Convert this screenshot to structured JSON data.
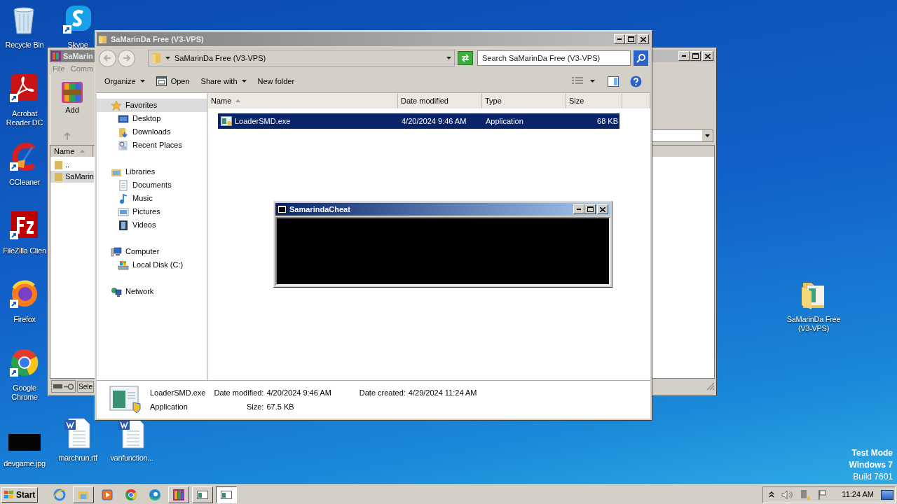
{
  "desktop": {
    "icons": [
      {
        "label": "Recycle Bin",
        "kind": "recycle",
        "shortcut": false
      },
      {
        "label": "Skype",
        "kind": "skype",
        "shortcut": true
      },
      {
        "label": "Acrobat Reader DC",
        "kind": "acrobat",
        "shortcut": true
      },
      {
        "label": "CCleaner",
        "kind": "ccleaner",
        "shortcut": true
      },
      {
        "label": "FileZilla Clien",
        "kind": "filezilla",
        "shortcut": true
      },
      {
        "label": "Firefox",
        "kind": "firefox",
        "shortcut": true
      },
      {
        "label": "Google Chrome",
        "kind": "chrome",
        "shortcut": true
      },
      {
        "label": "devgame.jpg",
        "kind": "image",
        "shortcut": false
      },
      {
        "label": "marchrun.rtf",
        "kind": "word",
        "shortcut": false
      },
      {
        "label": "vanfunction...",
        "kind": "word",
        "shortcut": false
      },
      {
        "label": "SaMarinDa Free (V3-VPS)",
        "kind": "folder",
        "shortcut": false
      }
    ],
    "os_notice": [
      "Test Mode",
      "Windows 7",
      "Build 7601"
    ]
  },
  "background_window": {
    "title": "SaMarin",
    "menu": [
      "File",
      "Comm"
    ],
    "toolbar": [
      "Add"
    ],
    "column": "Name",
    "rows": [
      {
        "name": "..",
        "selected": false
      },
      {
        "name": "SaMarin",
        "selected": true
      }
    ],
    "status": "Sele"
  },
  "explorer": {
    "title": "SaMarinDa Free (V3-VPS)",
    "address": "SaMarinDa Free (V3-VPS)",
    "search": {
      "placeholder": "Search SaMarinDa Free (V3-VPS)"
    },
    "toolbar": [
      {
        "label": "Organize",
        "kind": "menu"
      },
      {
        "label": "Open",
        "kind": "open"
      },
      {
        "label": "Share with",
        "kind": "menu"
      },
      {
        "label": "New folder",
        "kind": "plain"
      }
    ],
    "nav": [
      {
        "label": "Favorites",
        "kind": "star",
        "selected": true,
        "children": [
          {
            "label": "Desktop",
            "kind": "desktop",
            "selected": false
          },
          {
            "label": "Downloads",
            "kind": "downloads",
            "selected": false
          },
          {
            "label": "Recent Places",
            "kind": "recent",
            "selected": false
          }
        ]
      },
      {
        "label": "Libraries",
        "kind": "library",
        "selected": false,
        "children": [
          {
            "label": "Documents",
            "kind": "documents",
            "selected": false
          },
          {
            "label": "Music",
            "kind": "music",
            "selected": false
          },
          {
            "label": "Pictures",
            "kind": "pictures",
            "selected": false
          },
          {
            "label": "Videos",
            "kind": "videos",
            "selected": false
          }
        ]
      },
      {
        "label": "Computer",
        "kind": "computer",
        "selected": false,
        "children": [
          {
            "label": "Local Disk (C:)",
            "kind": "disk",
            "selected": false
          }
        ]
      },
      {
        "label": "Network",
        "kind": "network",
        "selected": false
      }
    ],
    "columns": [
      {
        "label": "Name",
        "sorted": true
      },
      {
        "label": "Date modified",
        "sorted": false
      },
      {
        "label": "Type",
        "sorted": false
      },
      {
        "label": "Size",
        "sorted": false
      }
    ],
    "rows": [
      {
        "name": "LoaderSMD.exe",
        "date": "4/20/2024 9:46 AM",
        "type": "Application",
        "size": "68 KB",
        "selected": true
      }
    ],
    "details": {
      "name": "LoaderSMD.exe",
      "type": "Application",
      "fields": [
        {
          "label": "Date modified:",
          "value": "4/20/2024 9:46 AM"
        },
        {
          "label": "Date created:",
          "value": "4/29/2024 11:24 AM"
        },
        {
          "label": "Size:",
          "value": "67.5 KB"
        }
      ]
    }
  },
  "console": {
    "title": "SamarindaCheat"
  },
  "taskbar": {
    "start": "Start",
    "apps": [
      {
        "kind": "ie",
        "selected": false
      },
      {
        "kind": "explorer",
        "selected": false
      },
      {
        "kind": "media",
        "selected": false
      },
      {
        "kind": "chrome",
        "selected": false
      },
      {
        "kind": "edge",
        "selected": false
      },
      {
        "kind": "winrar",
        "selected": false
      },
      {
        "kind": "window",
        "selected": false
      },
      {
        "kind": "window",
        "selected": true
      }
    ],
    "clock": "11:24 AM"
  }
}
